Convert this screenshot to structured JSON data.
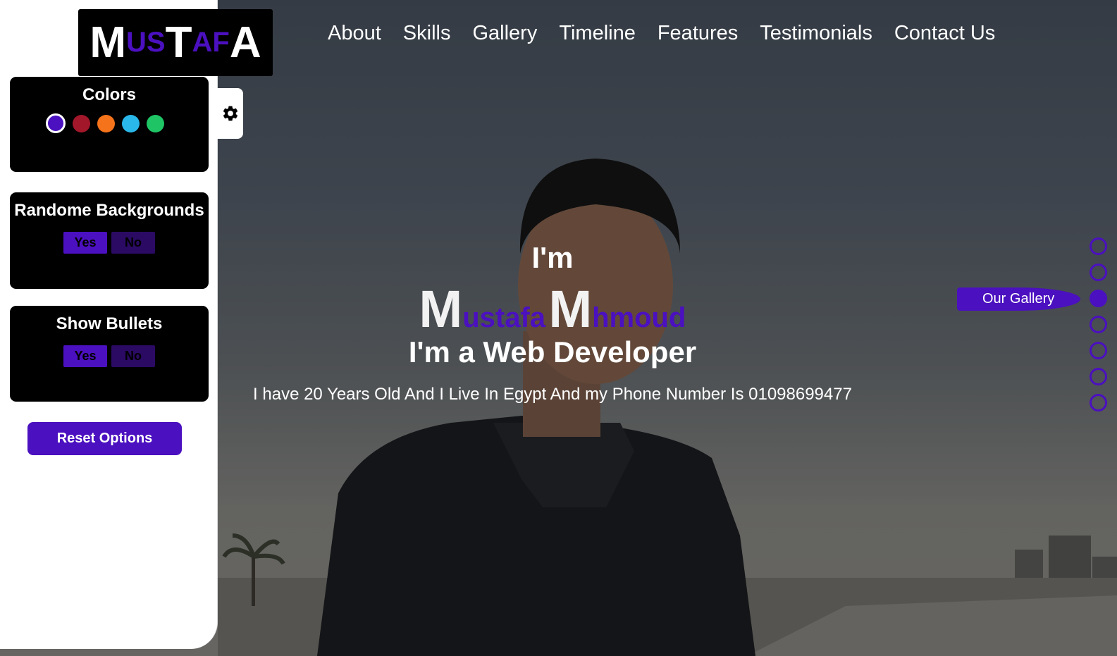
{
  "logo": {
    "parts": [
      {
        "text": "M",
        "style": "big"
      },
      {
        "text": "US",
        "style": "small"
      },
      {
        "text": "T",
        "style": "big"
      },
      {
        "text": "AF",
        "style": "small"
      },
      {
        "text": "A",
        "style": "big"
      }
    ]
  },
  "nav": {
    "items": [
      "About",
      "Skills",
      "Gallery",
      "Timeline",
      "Features",
      "Testimonials",
      "Contact Us"
    ]
  },
  "settings": {
    "gear_icon": "gear-icon",
    "colors": {
      "title": "Colors",
      "swatches": [
        "#4b10bf",
        "#a3172b",
        "#f5731b",
        "#2ab8ea",
        "#1fc565"
      ],
      "active_index": 0
    },
    "random_backgrounds": {
      "title": "Randome Backgrounds",
      "yes": "Yes",
      "no": "No"
    },
    "show_bullets": {
      "title": "Show Bullets",
      "yes": "Yes",
      "no": "No"
    },
    "reset_label": "Reset Options"
  },
  "hero": {
    "greeting": "I'm",
    "first_initial": "M",
    "first_rest": "ustafa",
    "last_initial": "M",
    "last_rest": "hmoud",
    "role": "I'm a Web Developer",
    "description": "I have 20 Years Old And I Live In Egypt And my Phone Number Is 01098699477"
  },
  "bullets": {
    "count": 7,
    "active_index": 2,
    "active_tooltip": "Our Gallery"
  },
  "colors": {
    "accent": "#4b10bf",
    "panel_bg": "#000000",
    "text": "#ffffff"
  }
}
